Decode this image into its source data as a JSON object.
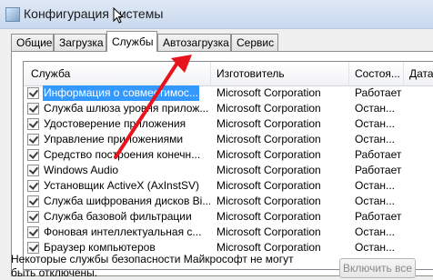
{
  "window": {
    "title": "Конфигурация системы"
  },
  "tabs": [
    {
      "label": "Общие",
      "active": false
    },
    {
      "label": "Загрузка",
      "active": false
    },
    {
      "label": "Службы",
      "active": true
    },
    {
      "label": "Автозагрузка",
      "active": false
    },
    {
      "label": "Сервис",
      "active": false
    }
  ],
  "table": {
    "headers": [
      "Служба",
      "Изготовитель",
      "Состоя...",
      "Дата от"
    ],
    "rows": [
      {
        "name": "Информация о совместимос...",
        "manufacturer": "Microsoft Corporation",
        "status": "Работает",
        "checked": true,
        "selected": true
      },
      {
        "name": "Служба шлюза уровня прилож...",
        "manufacturer": "Microsoft Corporation",
        "status": "Остан...",
        "checked": true,
        "selected": false
      },
      {
        "name": "Удостоверение приложения",
        "manufacturer": "Microsoft Corporation",
        "status": "Остан...",
        "checked": true,
        "selected": false
      },
      {
        "name": "Управление приложениями",
        "manufacturer": "Microsoft Corporation",
        "status": "Остан...",
        "checked": true,
        "selected": false
      },
      {
        "name": "Средство построения конечн...",
        "manufacturer": "Microsoft Corporation",
        "status": "Работает",
        "checked": true,
        "selected": false
      },
      {
        "name": "Windows Audio",
        "manufacturer": "Microsoft Corporation",
        "status": "Работает",
        "checked": true,
        "selected": false
      },
      {
        "name": "Установщик ActiveX (AxInstSV)",
        "manufacturer": "Microsoft Corporation",
        "status": "Остан...",
        "checked": true,
        "selected": false
      },
      {
        "name": "Служба шифрования дисков Bi...",
        "manufacturer": "Microsoft Corporation",
        "status": "Остан...",
        "checked": true,
        "selected": false
      },
      {
        "name": "Служба базовой фильтрации",
        "manufacturer": "Microsoft Corporation",
        "status": "Работает",
        "checked": true,
        "selected": false
      },
      {
        "name": "Фоновая интеллектуальная с...",
        "manufacturer": "Microsoft Corporation",
        "status": "Остан...",
        "checked": true,
        "selected": false
      },
      {
        "name": "Браузер компьютеров",
        "manufacturer": "Microsoft Corporation",
        "status": "Остан...",
        "checked": true,
        "selected": false
      }
    ]
  },
  "footer": {
    "note": "Некоторые службы безопасности Майкрософт не могут быть отключены.",
    "enable_all_label": "Включить все"
  },
  "colors": {
    "selection": "#3399ff",
    "annotation_arrow": "#e8141c"
  }
}
